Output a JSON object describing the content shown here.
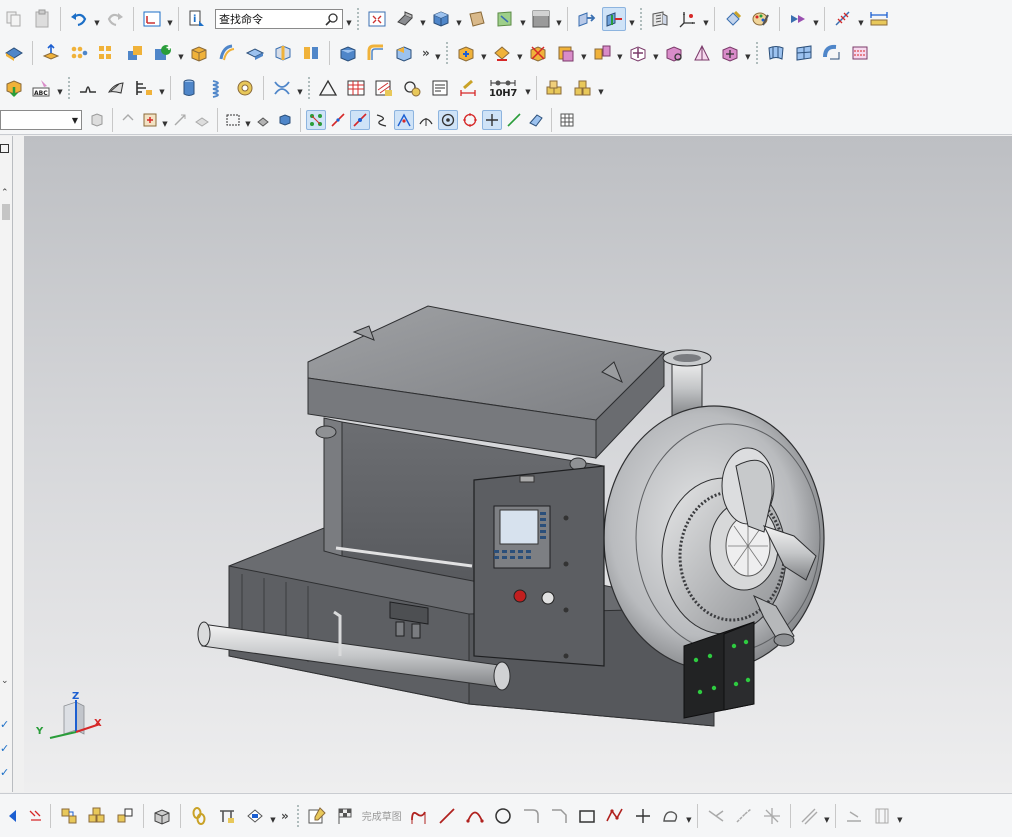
{
  "toolbar": {
    "search_value": "查找命令",
    "tolerance_label": "10H7",
    "more_glyph": "»",
    "selection_filter_value": ""
  },
  "sketch_bar": {
    "finish_sketch_label": "完成草图",
    "more_glyph": "»"
  },
  "left_panel": {
    "checks": [
      "✓",
      "✓",
      "✓"
    ],
    "scroll_up": "⌃",
    "scroll_down": "⌄"
  },
  "triad": {
    "x_label": "X",
    "y_label": "Y",
    "z_label": "Z"
  },
  "colors": {
    "viewport_top": "#bdbfc3",
    "viewport_bottom": "#eeeeef",
    "model_body": "#6e7074",
    "model_light": "#a8aaad",
    "accent_blue": "#1c6fc7",
    "triad_x": "#d62828",
    "triad_y": "#2a9d3a",
    "triad_z": "#1c5fd1"
  }
}
